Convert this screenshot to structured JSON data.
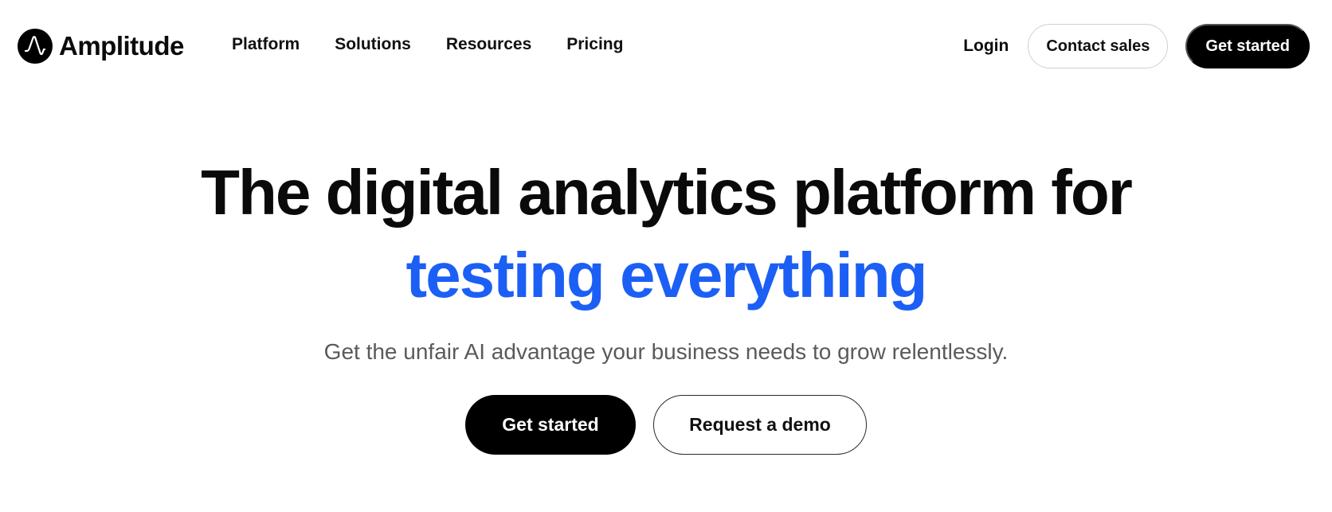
{
  "nav": {
    "brand": "Amplitude",
    "links": [
      "Platform",
      "Solutions",
      "Resources",
      "Pricing"
    ],
    "login": "Login",
    "contact_sales": "Contact sales",
    "get_started": "Get started"
  },
  "hero": {
    "headline_line1": "The digital analytics platform for",
    "headline_line2": "testing everything",
    "subhead": "Get the unfair AI advantage your business needs to grow relentlessly.",
    "primary_cta": "Get started",
    "secondary_cta": "Request a demo"
  },
  "colors": {
    "accent": "#1c5ff5",
    "button_black": "#000000",
    "text_muted": "#5a5a5a"
  },
  "icons": {
    "brand_logo": "amplitude-logo-icon"
  }
}
